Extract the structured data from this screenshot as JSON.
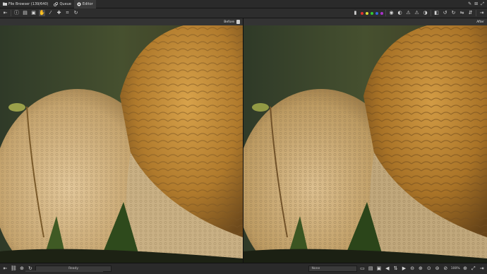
{
  "tabs": [
    {
      "label": "File Browser (139/640)",
      "icon": "folder-icon"
    },
    {
      "label": "Queue",
      "icon": "queue-icon"
    },
    {
      "label": "Editor",
      "icon": "editor-icon",
      "active": true
    }
  ],
  "panels": {
    "before_label": "Before",
    "after_label": "After"
  },
  "status": {
    "state_text": "Ready",
    "profile_select": "None",
    "zoom_level": "100%"
  },
  "colors": {
    "accent": "#3a3a3a",
    "label_red": "#d33",
    "label_yellow": "#dd3",
    "label_green": "#3c3",
    "label_blue": "#36d",
    "label_purple": "#a3c"
  }
}
